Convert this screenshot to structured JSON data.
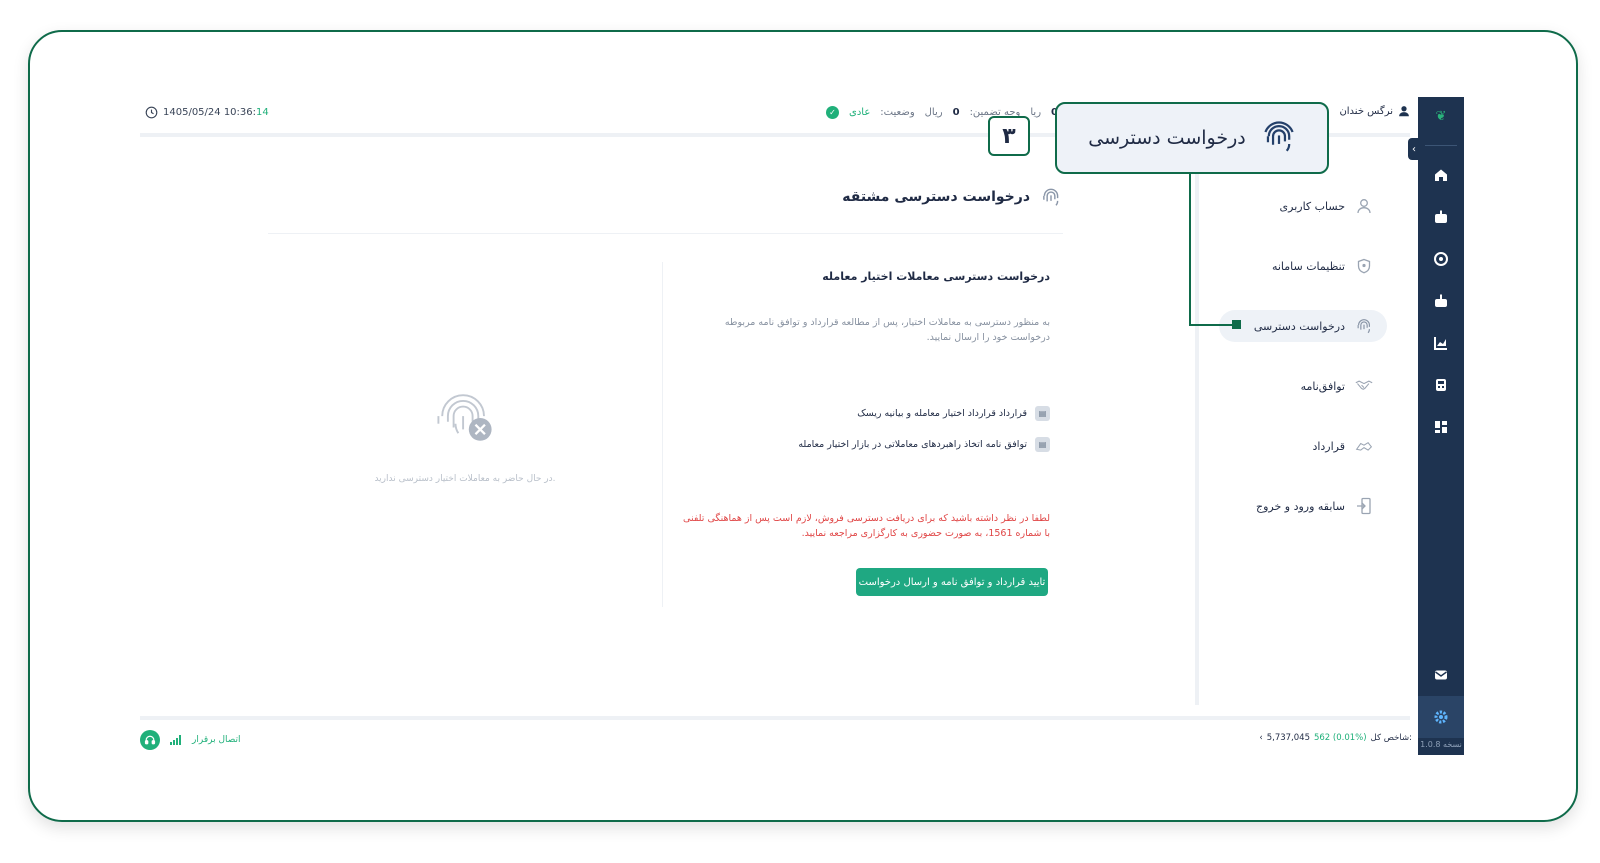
{
  "topbar": {
    "date": "1405/05/24 10:36:",
    "seconds": "14",
    "status_label": "وضعیت:",
    "status_value": "عادی",
    "guarantee_label": "وجه تضمین:",
    "guarantee_amount": "0",
    "guarantee_unit": "ریال",
    "balance_amount": "0",
    "balance_unit": "ریا",
    "user_name": "نرگس خندان"
  },
  "callout": {
    "label": "درخواست دسترسی",
    "step": "۳"
  },
  "rail": {
    "logo_icon": "leaf-logo-icon",
    "version": "نسخه 1.0.8"
  },
  "sidebar": {
    "items": [
      {
        "label": "حساب کاربری",
        "icon": "user-icon"
      },
      {
        "label": "تنظیمات سامانه",
        "icon": "shield-icon"
      },
      {
        "label": "درخواست دسترسی",
        "icon": "fingerprint-icon",
        "active": true
      },
      {
        "label": "توافق‌نامه",
        "icon": "handshake-icon"
      },
      {
        "label": "قرارداد",
        "icon": "agreement-icon"
      },
      {
        "label": "سابقه ورود و خروج",
        "icon": "logout-icon"
      }
    ]
  },
  "main": {
    "title": "درخواست دسترسی مشتقه",
    "card_title": "درخواست دسترسی معاملات اختیار معامله",
    "card_desc": "به منظور دسترسی به معاملات اختیار، پس از مطالعه قرارداد و توافق نامه مربوطه درخواست خود را ارسال نمایید.",
    "documents": [
      "قرارداد قرارداد اختیار معامله و بیانیه ریسک",
      "توافق نامه اتخاذ راهبردهای معاملاتی در بازار اختیار معامله"
    ],
    "warning": "لطفا در نظر داشته باشید که برای دریافت دسترسی فروش، لازم است پس از هماهنگی تلفنی با شماره 1561، به صورت حضوری به کارگزاری مراجعه نمایید.",
    "confirm_button": "تایید قرارداد و توافق نامه و ارسال درخواست",
    "empty_text": "در حال حاضر به معاملات اختیار دسترسی ندارید."
  },
  "footer": {
    "connection": "اتصال برقرار",
    "index_label": "شاخص کل:",
    "index_value": "5,737,045",
    "index_change": "562 (0.01%)"
  },
  "colors": {
    "accent": "#1fa882",
    "rail": "#1e3350",
    "callout_border": "#0f6b4a",
    "warning": "#e04646"
  }
}
